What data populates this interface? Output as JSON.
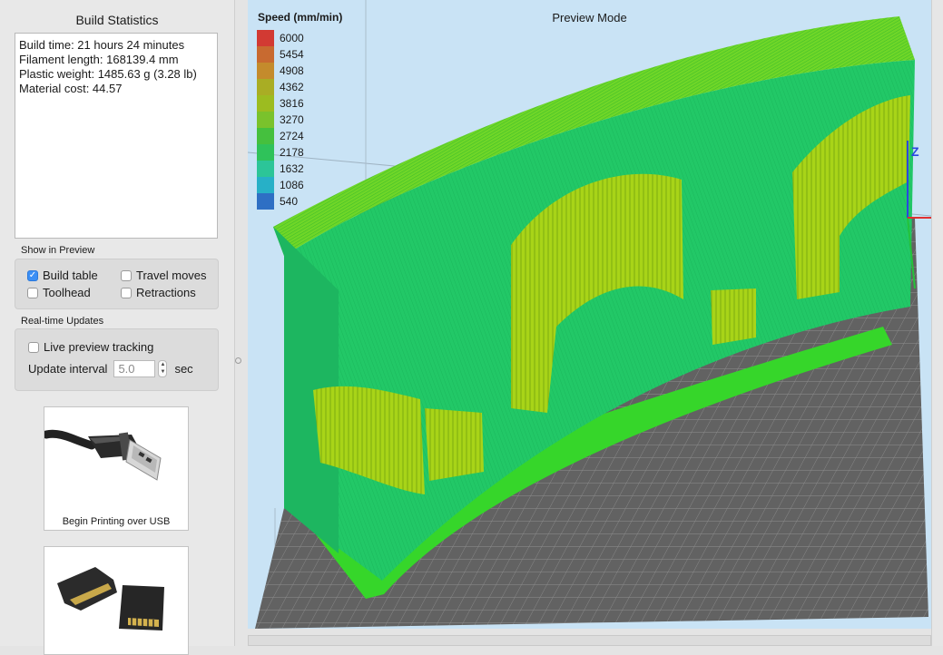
{
  "build_statistics": {
    "title": "Build Statistics",
    "lines": [
      "Build time: 21 hours 24 minutes",
      "Filament length: 168139.4 mm",
      "Plastic weight: 1485.63 g (3.28 lb)",
      "Material cost: 44.57"
    ]
  },
  "show_in_preview": {
    "label": "Show in Preview",
    "options": [
      {
        "label": "Build table",
        "checked": true
      },
      {
        "label": "Travel moves",
        "checked": false
      },
      {
        "label": "Toolhead",
        "checked": false
      },
      {
        "label": "Retractions",
        "checked": false
      }
    ]
  },
  "realtime_updates": {
    "label": "Real-time Updates",
    "live_tracking_label": "Live preview tracking",
    "live_tracking_checked": false,
    "interval_label": "Update interval",
    "interval_value": "5.0",
    "interval_unit": "sec"
  },
  "print_options": {
    "usb_caption": "Begin Printing over USB"
  },
  "viewport": {
    "mode_title": "Preview Mode",
    "legend_title": "Speed (mm/min)",
    "legend": [
      {
        "value": "6000",
        "color": "#d23a33"
      },
      {
        "value": "5454",
        "color": "#c86a30"
      },
      {
        "value": "4908",
        "color": "#c48b2c"
      },
      {
        "value": "4362",
        "color": "#a9ad24"
      },
      {
        "value": "3816",
        "color": "#9cbc20"
      },
      {
        "value": "3270",
        "color": "#7ac22c"
      },
      {
        "value": "2724",
        "color": "#45c03e"
      },
      {
        "value": "2178",
        "color": "#2fc25a"
      },
      {
        "value": "1632",
        "color": "#2cc598"
      },
      {
        "value": "1086",
        "color": "#27b0c7"
      },
      {
        "value": "540",
        "color": "#2e6fc4"
      }
    ],
    "axis_label": "Z"
  },
  "colors": {
    "model_green": "#22c86a",
    "infill_yellow": "#a9d414",
    "plate_gray": "#5e5e5e",
    "sky_blue": "#c9e3f5"
  }
}
